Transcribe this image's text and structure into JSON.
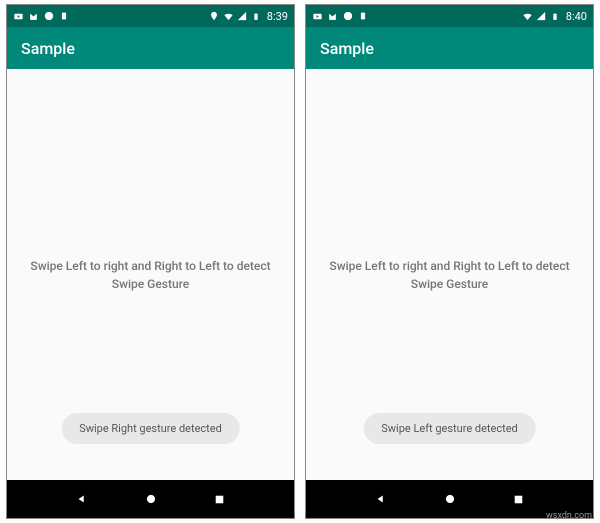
{
  "screens": [
    {
      "status": {
        "time": "8:39"
      },
      "app_bar": {
        "title": "Sample"
      },
      "content": {
        "instruction": "Swipe Left to right and Right to Left to detect Swipe Gesture"
      },
      "toast": {
        "message": "Swipe Right gesture detected"
      }
    },
    {
      "status": {
        "time": "8:40"
      },
      "app_bar": {
        "title": "Sample"
      },
      "content": {
        "instruction": "Swipe Left to right and Right to Left to detect Swipe Gesture"
      },
      "toast": {
        "message": "Swipe Left gesture detected"
      }
    }
  ],
  "watermark": "wsxdn.com",
  "colors": {
    "status_bar": "#00695c",
    "app_bar": "#00897b",
    "content_bg": "#fafafa",
    "text_muted": "#757575",
    "nav_bar": "#000000"
  }
}
